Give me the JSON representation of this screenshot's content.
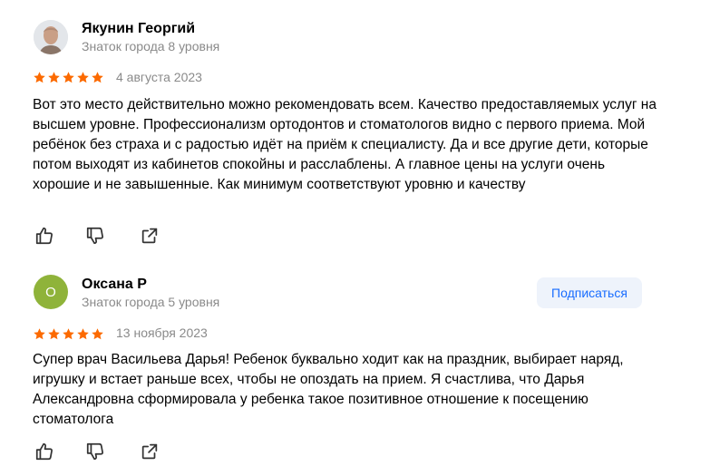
{
  "reviews": [
    {
      "author": "Якунин Георгий",
      "level": "Знаток города 8 уровня",
      "rating": 5,
      "date": "4 августа 2023",
      "text": "Вот это место действительно можно рекомендовать всем. Качество предоставляемых услуг на высшем уровне. Профессионализм ортодонтов и стоматологов видно с первого приема. Мой ребёнок без страха и с радостью идёт на приём к специалисту. Да и все другие дети, которые потом выходят из кабинетов спокойны и расслаблены. А главное цены на услуги очень хорошие и не завышенные. Как минимум соответствуют уровню и качеству",
      "avatar_type": "photo"
    },
    {
      "author": "Оксана Р",
      "level": "Знаток города 5 уровня",
      "rating": 5,
      "date": "13 ноября 2023",
      "text": "Супер врач Васильева Дарья! Ребенок буквально ходит как на праздник, выбирает наряд, игрушку и встает раньше всех, чтобы не опоздать на прием. Я счастлива, что Дарья Александровна сформировала у ребенка такое позитивное отношение к посещению стоматолога",
      "avatar_letter": "О",
      "avatar_color": "#8fb33a",
      "subscribe_label": "Подписаться"
    }
  ],
  "colors": {
    "star": "#fc6a00",
    "accent": "#196dff",
    "muted": "#8a8a8a"
  },
  "icons": [
    "thumbs-up-icon",
    "thumbs-down-icon",
    "share-icon"
  ]
}
